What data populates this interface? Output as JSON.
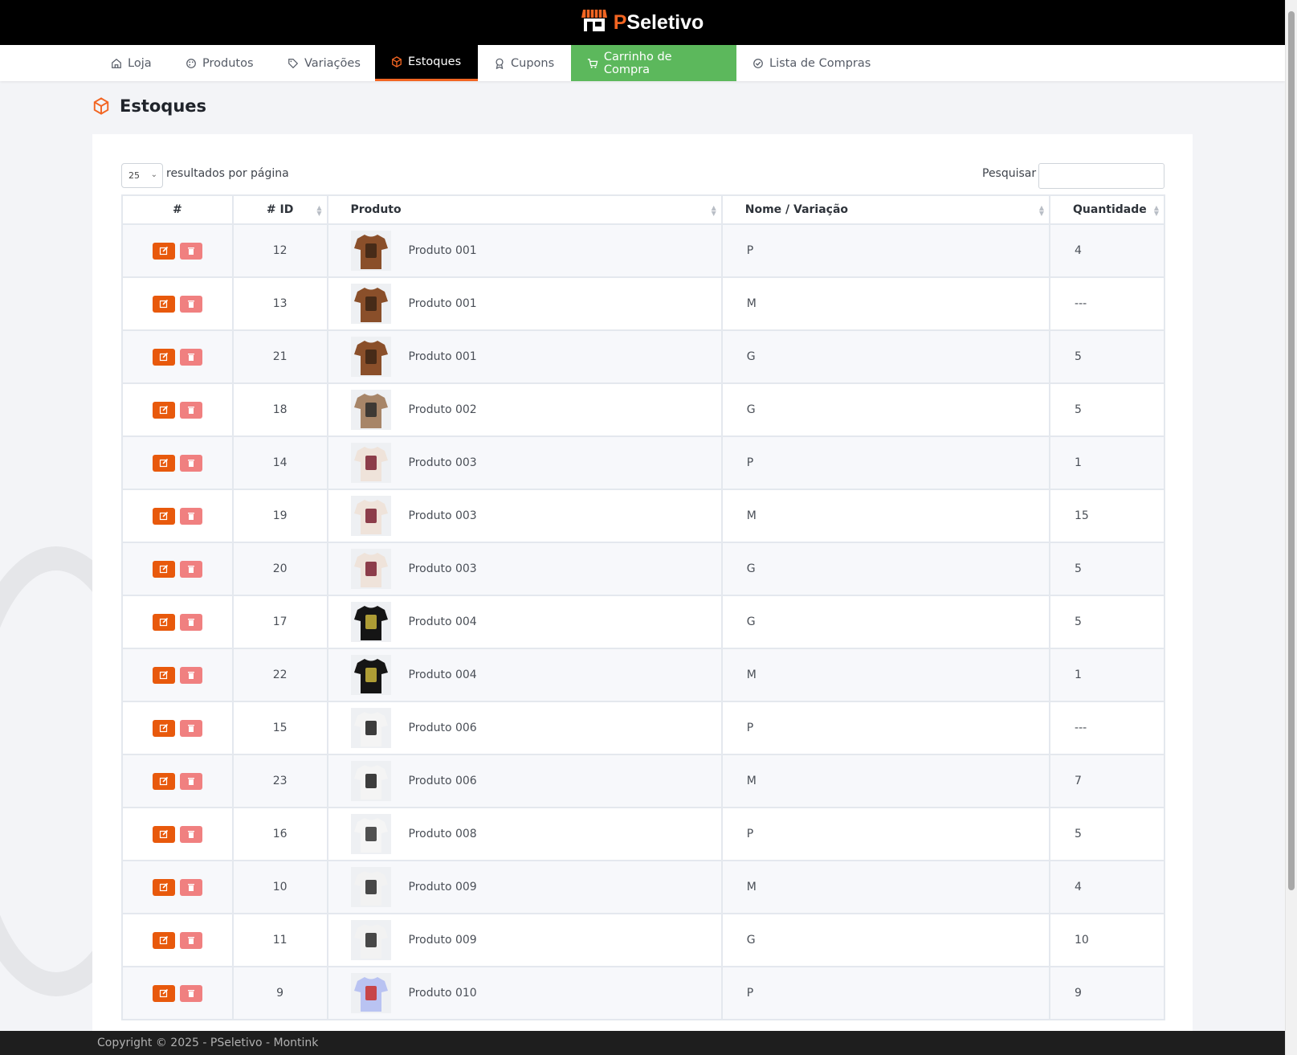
{
  "brand": {
    "name_prefix": "P",
    "name_rest": "Seletivo"
  },
  "nav": [
    {
      "label": "Loja",
      "icon": "home-icon"
    },
    {
      "label": "Produtos",
      "icon": "palette-icon"
    },
    {
      "label": "Variações",
      "icon": "tag-icon"
    },
    {
      "label": "Estoques",
      "icon": "box-icon",
      "active": true
    },
    {
      "label": "Cupons",
      "icon": "award-icon"
    },
    {
      "label": "Carrinho de Compra",
      "icon": "cart-icon"
    },
    {
      "label": "Lista de Compras",
      "icon": "check-circle-icon"
    }
  ],
  "page": {
    "title": "Estoques"
  },
  "table_controls": {
    "page_length": "25",
    "page_length_label": "resultados por página",
    "search_label": "Pesquisar"
  },
  "columns": [
    "#",
    "# ID",
    "Produto",
    "Nome / Variação",
    "Quantidade"
  ],
  "rows": [
    {
      "id": "12",
      "product": "Produto 001",
      "variation": "P",
      "qty": "4",
      "thumb": "brown"
    },
    {
      "id": "13",
      "product": "Produto 001",
      "variation": "M",
      "qty": "---",
      "thumb": "brown"
    },
    {
      "id": "21",
      "product": "Produto 001",
      "variation": "G",
      "qty": "5",
      "thumb": "brown"
    },
    {
      "id": "18",
      "product": "Produto 002",
      "variation": "G",
      "qty": "5",
      "thumb": "tan"
    },
    {
      "id": "14",
      "product": "Produto 003",
      "variation": "P",
      "qty": "1",
      "thumb": "cream"
    },
    {
      "id": "19",
      "product": "Produto 003",
      "variation": "M",
      "qty": "15",
      "thumb": "cream"
    },
    {
      "id": "20",
      "product": "Produto 003",
      "variation": "G",
      "qty": "5",
      "thumb": "cream"
    },
    {
      "id": "17",
      "product": "Produto 004",
      "variation": "G",
      "qty": "5",
      "thumb": "black"
    },
    {
      "id": "22",
      "product": "Produto 004",
      "variation": "M",
      "qty": "1",
      "thumb": "black"
    },
    {
      "id": "15",
      "product": "Produto 006",
      "variation": "P",
      "qty": "---",
      "thumb": "white-print"
    },
    {
      "id": "23",
      "product": "Produto 006",
      "variation": "M",
      "qty": "7",
      "thumb": "white-print"
    },
    {
      "id": "16",
      "product": "Produto 008",
      "variation": "P",
      "qty": "5",
      "thumb": "white-cat"
    },
    {
      "id": "10",
      "product": "Produto 009",
      "variation": "M",
      "qty": "4",
      "thumb": "white-box"
    },
    {
      "id": "11",
      "product": "Produto 009",
      "variation": "G",
      "qty": "10",
      "thumb": "white-box"
    },
    {
      "id": "9",
      "product": "Produto 010",
      "variation": "P",
      "qty": "9",
      "thumb": "lilac"
    }
  ],
  "thumb_colors": {
    "brown": [
      "#8a4f2a",
      "#3b2415"
    ],
    "tan": [
      "#a78568",
      "#2c2c2c"
    ],
    "cream": [
      "#efe3da",
      "#7a2030"
    ],
    "black": [
      "#151515",
      "#c9b53b"
    ],
    "white-print": [
      "#f4f4f4",
      "#1b1b1b"
    ],
    "white-cat": [
      "#f5f5f5",
      "#333333"
    ],
    "white-box": [
      "#f2f2f2",
      "#2a2a2a"
    ],
    "lilac": [
      "#b9c3f2",
      "#c9302c"
    ]
  },
  "footer": {
    "text": "Copyright © 2025 - PSeletivo - Montink"
  },
  "colors": {
    "accent": "#f26522",
    "cart": "#5cb85c",
    "edit": "#e8590c",
    "delete": "#f08080"
  }
}
